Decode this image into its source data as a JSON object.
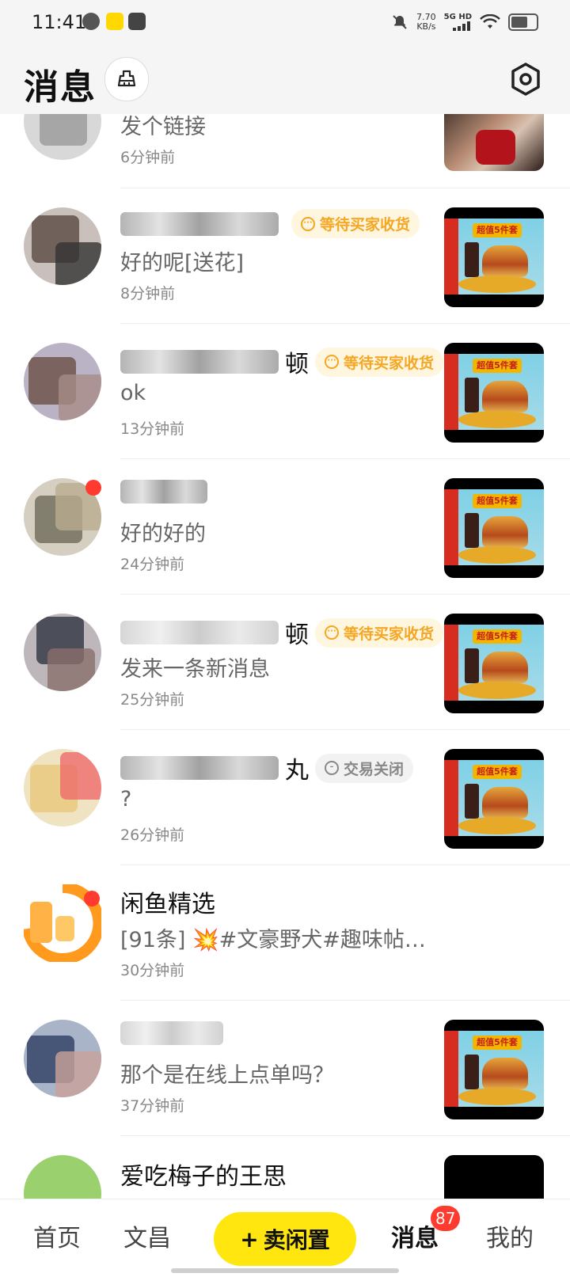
{
  "status": {
    "time": "11:41",
    "speed_value": "7.70",
    "speed_unit": "KB/s",
    "network": "5G HD"
  },
  "header": {
    "title": "消息"
  },
  "conversations": [
    {
      "name": "",
      "message": "发个链接",
      "time": "6分钟前",
      "badge": "",
      "unread": false
    },
    {
      "name": "",
      "message": "好的呢[送花]",
      "time": "8分钟前",
      "badge": "等待买家收货",
      "unread": false
    },
    {
      "name": "顿",
      "message": "ok",
      "time": "13分钟前",
      "badge": "等待买家收货",
      "unread": false
    },
    {
      "name": "",
      "message": "好的好的",
      "time": "24分钟前",
      "badge": "",
      "unread": true
    },
    {
      "name": "顿",
      "message": "发来一条新消息",
      "time": "25分钟前",
      "badge": "等待买家收货",
      "unread": false
    },
    {
      "name": "丸",
      "message": "?",
      "time": "26分钟前",
      "badge": "交易关闭",
      "unread": false
    },
    {
      "name": "闲鱼精选",
      "message": "[91条] 💥#文豪野犬#趣味帖…",
      "time": "30分钟前",
      "badge": "",
      "unread": true
    },
    {
      "name": "",
      "message": "那个是在线上点单吗？",
      "time": "37分钟前",
      "badge": "",
      "unread": false
    },
    {
      "name": "爱吃梅子的王思",
      "message": "",
      "time": "",
      "badge": "",
      "unread": false
    }
  ],
  "product_thumb": {
    "banner": "超值5件套"
  },
  "tabbar": {
    "home": "首页",
    "wenchang": "文昌",
    "sell": "卖闲置",
    "sell_icon": "+",
    "messages": "消息",
    "messages_count": "87",
    "mine": "我的"
  },
  "colors": {
    "accent": "#ffe60f",
    "badge_text": "#f5a623",
    "unread": "#ff3b30"
  }
}
